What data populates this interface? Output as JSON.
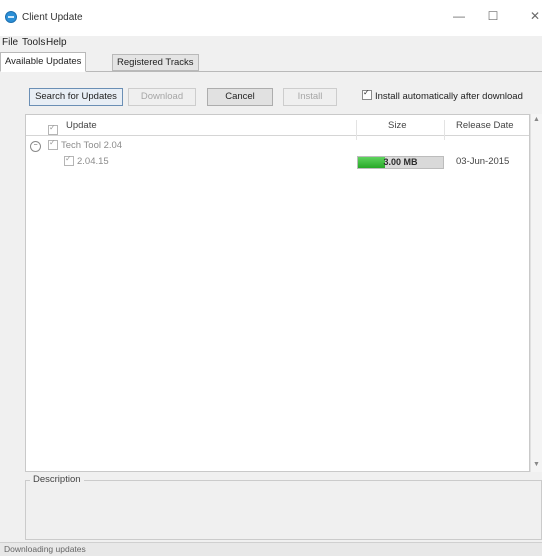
{
  "window": {
    "title": "Client Update",
    "controls": {
      "minimize": "—",
      "maximize": "☐",
      "close": "✕"
    }
  },
  "menu": [
    "File",
    "Tools",
    "Help"
  ],
  "tabs": [
    {
      "label": "Available Updates",
      "active": true
    },
    {
      "label": "Registered Tracks",
      "active": false
    }
  ],
  "toolbar": {
    "search_label": "Search for Updates",
    "download_label": "Download",
    "cancel_label": "Cancel",
    "install_label": "Install",
    "auto_install_label": "Install automatically after download",
    "auto_install_checked": true
  },
  "tree": {
    "columns": {
      "update": "Update",
      "size": "Size",
      "release_date": "Release Date"
    },
    "rows": [
      {
        "label": "Tech Tool 2.04",
        "checked": true,
        "expanded": true
      },
      {
        "label": "2.04.15",
        "checked": true,
        "size": "3.00 MB",
        "progress_pct": 32,
        "release_date": "03-Jun-2015"
      }
    ]
  },
  "description": {
    "legend": "Description"
  },
  "status": {
    "text": "Downloading updates"
  },
  "colors": {
    "accent": "#2b8fd6",
    "progress": "#28a828"
  }
}
